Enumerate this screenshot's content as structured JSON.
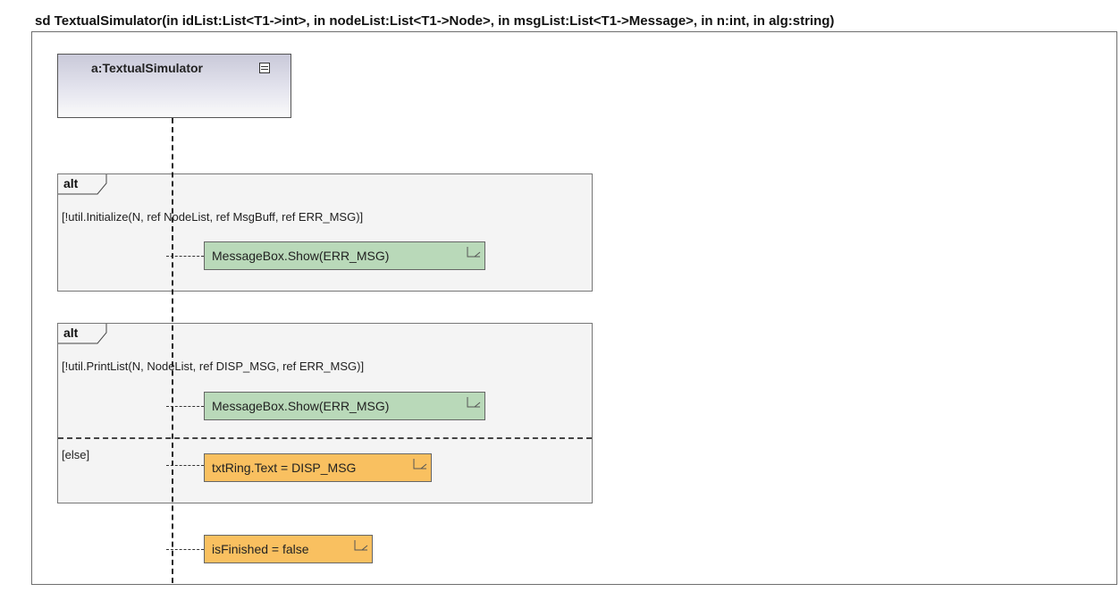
{
  "diagram": {
    "frame_title": "sd TextualSimulator(in idList:List<T1->int>, in nodeList:List<T1->Node>, in msgList:List<T1->Message>, in n:int, in alg:string)",
    "lifeline": {
      "name": "a:TextualSimulator",
      "icon": "class-icon"
    },
    "fragments": [
      {
        "operator": "alt",
        "guard": "[!util.Initialize(N, ref NodeList, ref MsgBuff, ref ERR_MSG)]",
        "note": "MessageBox.Show(ERR_MSG)"
      },
      {
        "operator": "alt",
        "guard": "[!util.PrintList(N, NodeList, ref DISP_MSG, ref ERR_MSG)]",
        "note": "MessageBox.Show(ERR_MSG)",
        "else_guard": "[else]",
        "else_note": "txtRing.Text = DISP_MSG"
      }
    ],
    "final_note": "isFinished = false",
    "colors": {
      "note_green": "#b9d9b9",
      "note_orange": "#f9c060",
      "fragment_bg": "#f4f4f4"
    }
  }
}
